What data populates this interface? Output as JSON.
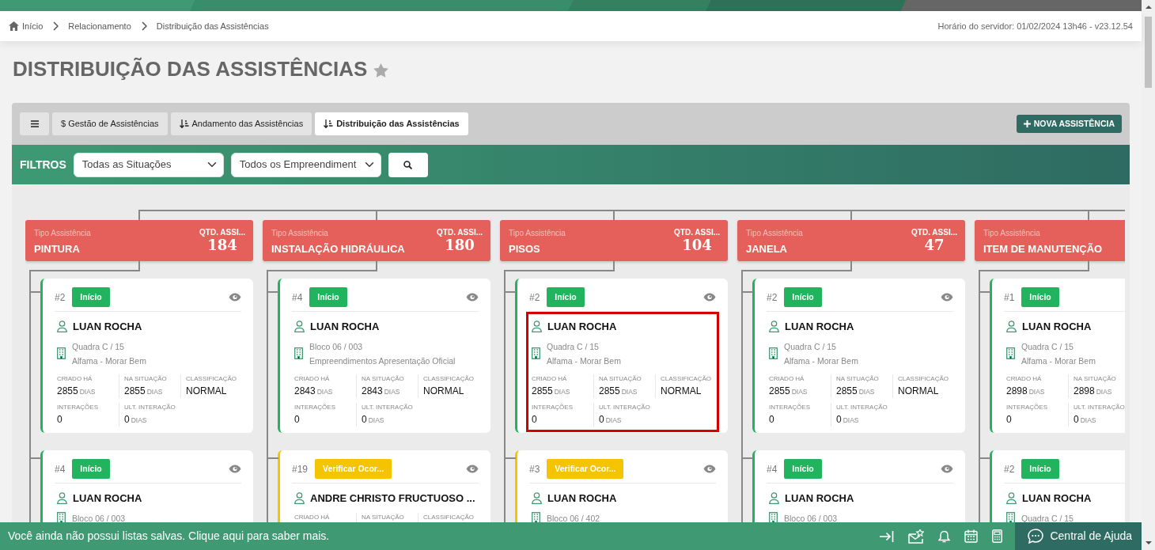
{
  "breadcrumb": [
    "Início",
    "Relacionamento",
    "Distribuição das Assistências"
  ],
  "server_time": "Horário do servidor: 01/02/2024 13h46 - v23.12.54",
  "page_title": "DISTRIBUIÇÃO DAS ASSISTÊNCIAS",
  "favorite": false,
  "tabs": [
    {
      "label": "$ Gestão de Assistências",
      "kind": "plain",
      "selected": false
    },
    {
      "label": "Andamento das Assistências",
      "kind": "sort",
      "selected": false
    },
    {
      "label": "Distribuição das Assistências",
      "kind": "sort",
      "selected": true
    }
  ],
  "new_button": "NOVA ASSISTÊNCIA",
  "filters": {
    "label": "FILTROS",
    "selects": [
      {
        "value": "Todas as Situações"
      },
      {
        "value": "Todos os Empreendiment"
      }
    ]
  },
  "columns": [
    {
      "type_label": "Tipo Assistência",
      "title": "PINTURA",
      "qty_label": "QTD. ASSI...",
      "qty": "184",
      "cards": [
        {
          "number": "#2",
          "status": {
            "label": "Início",
            "color": "#22b35e"
          },
          "highlighted": false,
          "name": "LUAN ROCHA",
          "unit": "Quadra C / 15",
          "development": "Alfama - Morar Bem",
          "stats": [
            [
              {
                "label": "CRIADO HÁ",
                "value": "2855",
                "unit": "DIAS"
              },
              {
                "label": "NA SITUAÇÃO",
                "value": "2855",
                "unit": "DIAS"
              },
              {
                "label": "CLASSIFICAÇÃO",
                "value": "NORMAL"
              }
            ],
            [
              {
                "label": "INTERAÇÕES",
                "value": "0"
              },
              {
                "label": "ULT. INTERAÇÃO",
                "value": "0",
                "unit": "DIAS"
              }
            ]
          ]
        },
        {
          "number": "#4",
          "status": {
            "label": "Início",
            "color": "#22b35e"
          },
          "highlighted": false,
          "name": "LUAN ROCHA",
          "unit": "Bloco 06 / 003"
        }
      ]
    },
    {
      "type_label": "Tipo Assistência",
      "title": "INSTALAÇÃO HIDRÁULICA",
      "qty_label": "QTD. ASSI...",
      "qty": "180",
      "cards": [
        {
          "number": "#4",
          "status": {
            "label": "Início",
            "color": "#22b35e"
          },
          "highlighted": false,
          "name": "LUAN ROCHA",
          "unit": "Bloco 06 / 003",
          "development": "Empreendimentos Apresentação Oficial",
          "stats": [
            [
              {
                "label": "CRIADO HÁ",
                "value": "2843",
                "unit": "DIAS"
              },
              {
                "label": "NA SITUAÇÃO",
                "value": "2843",
                "unit": "DIAS"
              },
              {
                "label": "CLASSIFICAÇÃO",
                "value": "NORMAL"
              }
            ],
            [
              {
                "label": "INTERAÇÕES",
                "value": "0"
              },
              {
                "label": "ULT. INTERAÇÃO",
                "value": "0",
                "unit": "DIAS"
              }
            ]
          ]
        },
        {
          "number": "#19",
          "status": {
            "label": "Verificar Ocor...",
            "color": "#f5c400"
          },
          "highlighted": false,
          "name": "ANDRE CHRISTO FRUCTUOSO ...",
          "stats": [
            [
              {
                "label": "CRIADO HÁ"
              },
              {
                "label": "NA SITUAÇÃO"
              },
              {
                "label": "CLASSIFICAÇÃO"
              }
            ]
          ]
        }
      ]
    },
    {
      "type_label": "Tipo Assistência",
      "title": "PISOS",
      "qty_label": "QTD. ASSI...",
      "qty": "104",
      "cards": [
        {
          "number": "#2",
          "status": {
            "label": "Início",
            "color": "#22b35e"
          },
          "highlighted": true,
          "name": "LUAN ROCHA",
          "unit": "Quadra C / 15",
          "development": "Alfama - Morar Bem",
          "stats": [
            [
              {
                "label": "CRIADO HÁ",
                "value": "2855",
                "unit": "DIAS"
              },
              {
                "label": "NA SITUAÇÃO",
                "value": "2855",
                "unit": "DIAS"
              },
              {
                "label": "CLASSIFICAÇÃO",
                "value": "NORMAL"
              }
            ],
            [
              {
                "label": "INTERAÇÕES",
                "value": "0"
              },
              {
                "label": "ULT. INTERAÇÃO",
                "value": "0",
                "unit": "DIAS"
              }
            ]
          ]
        },
        {
          "number": "#3",
          "status": {
            "label": "Verificar Ocor...",
            "color": "#f5c400"
          },
          "highlighted": false,
          "name": "LUAN ROCHA",
          "unit": "Bloco 06 / 402"
        }
      ]
    },
    {
      "type_label": "Tipo Assistência",
      "title": "JANELA",
      "qty_label": "QTD. ASSI...",
      "qty": "47",
      "cards": [
        {
          "number": "#2",
          "status": {
            "label": "Início",
            "color": "#22b35e"
          },
          "highlighted": false,
          "name": "LUAN ROCHA",
          "unit": "Quadra C / 15",
          "development": "Alfama - Morar Bem",
          "stats": [
            [
              {
                "label": "CRIADO HÁ",
                "value": "2855",
                "unit": "DIAS"
              },
              {
                "label": "NA SITUAÇÃO",
                "value": "2855",
                "unit": "DIAS"
              },
              {
                "label": "CLASSIFICAÇÃO",
                "value": "NORMAL"
              }
            ],
            [
              {
                "label": "INTERAÇÕES",
                "value": "0"
              },
              {
                "label": "ULT. INTERAÇÃO",
                "value": "0",
                "unit": "DIAS"
              }
            ]
          ]
        },
        {
          "number": "#4",
          "status": {
            "label": "Início",
            "color": "#22b35e"
          },
          "highlighted": false,
          "name": "LUAN ROCHA",
          "unit": "Bloco 06 / 003"
        }
      ]
    },
    {
      "type_label": "Tipo Assistência",
      "title": "ITEM DE MANUTENÇÃO",
      "cards": [
        {
          "number": "#1",
          "status": {
            "label": "Início",
            "color": "#22b35e"
          },
          "highlighted": false,
          "name": "LUAN ROCHA",
          "unit": "Quadra C / 15",
          "development": "Alfama - Morar Bem",
          "stats": [
            [
              {
                "label": "CRIADO HÁ",
                "value": "2898",
                "unit": "DIAS"
              },
              {
                "label": "NA SITUAÇÃO",
                "value": "2898",
                "unit": "DIAS"
              }
            ],
            [
              {
                "label": "INTERAÇÕES",
                "value": "0"
              },
              {
                "label": "ULT. INTERAÇÃO",
                "value": "0",
                "unit": "DIAS"
              }
            ]
          ]
        },
        {
          "number": "#2",
          "status": {
            "label": "Início",
            "color": "#22b35e"
          },
          "highlighted": false,
          "name": "LUAN ROCHA",
          "unit": "Quadra C / 15"
        }
      ]
    }
  ],
  "footer": {
    "message": "Você ainda não possui listas salvas. Clique aqui para saber mais.",
    "help": "Central de Ajuda"
  }
}
